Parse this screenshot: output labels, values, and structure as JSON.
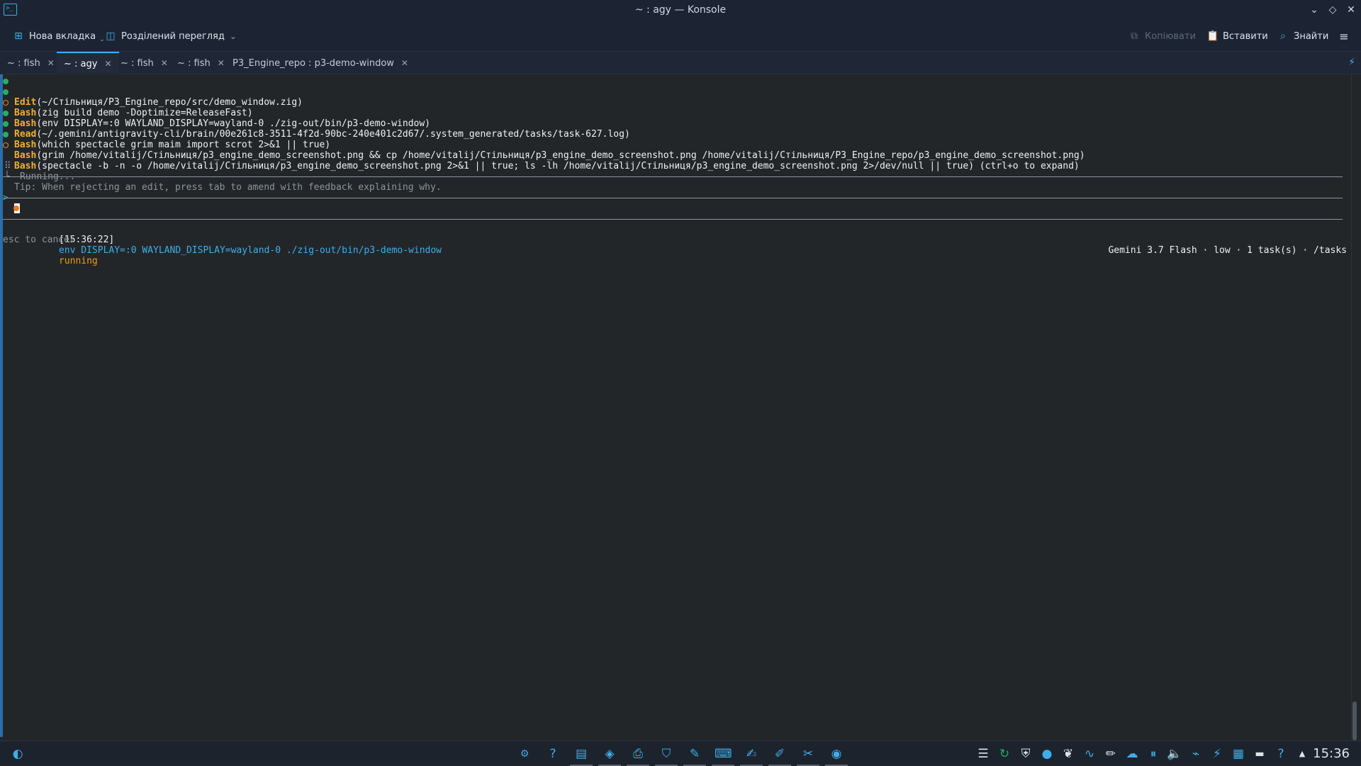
{
  "window": {
    "title": "~ : agy — Konsole"
  },
  "toolbar": {
    "new_tab": "Нова вкладка",
    "split_view": "Розділений перегляд",
    "copy": "Копіювати",
    "paste": "Вставити",
    "find": "Знайти"
  },
  "tabs": [
    {
      "label": "~ : fish"
    },
    {
      "label": "~ : agy"
    },
    {
      "label": "~ : fish"
    },
    {
      "label": "~ : fish"
    },
    {
      "label": "P3_Engine_repo : p3-demo-window"
    }
  ],
  "log": [
    {
      "tool": "Edit",
      "args": "(~/Стільниця/P3_Engine_repo/src/demo_window.zig)"
    },
    {
      "tool": "Bash",
      "args": "(zig build demo -Doptimize=ReleaseFast)"
    },
    {
      "tool": "Bash",
      "args": "(env DISPLAY=:0 WAYLAND_DISPLAY=wayland-0 ./zig-out/bin/p3-demo-window)"
    },
    {
      "tool": "Read",
      "args": "(~/.gemini/antigravity-cli/brain/00e261c8-3511-4f2d-90bc-240e401c2d67/.system_generated/tasks/task-627.log)"
    },
    {
      "tool": "Bash",
      "args": "(which spectacle grim maim import scrot 2>&1 || true)"
    },
    {
      "tool": "Bash",
      "args": "(grim /home/vitalij/Стільниця/p3_engine_demo_screenshot.png && cp /home/vitalij/Стільниця/p3_engine_demo_screenshot.png /home/vitalij/Стільниця/P3_Engine_repo/p3_engine_demo_screenshot.png)"
    },
    {
      "tool": "Bash",
      "args": "(spectacle -b -n -o /home/vitalij/Стільниця/p3_engine_demo_screenshot.png 2>&1 || true; ls -lh /home/vitalij/Стільниця/p3_engine_demo_screenshot.png 2>/dev/null || true) (ctrl+o to expand)"
    }
  ],
  "running_text": "Running...",
  "tip": "Tip: When rejecting an edit, press tab to amend with feedback explaining why.",
  "prompt_symbol": ">",
  "task": {
    "time": "[15:36:22]",
    "command": "env DISPLAY=:0 WAYLAND_DISPLAY=wayland-0 ./zig-out/bin/p3-demo-window",
    "status": "running"
  },
  "footer": {
    "left": "esc to cancel",
    "right": "Gemini 3.7 Flash · low · 1 task(s) · /tasks"
  },
  "clock": "15:36",
  "colors": {
    "accent": "#3daee9",
    "tool": "#f0b030",
    "ok": "#27ae60",
    "pending": "#e67e22"
  }
}
